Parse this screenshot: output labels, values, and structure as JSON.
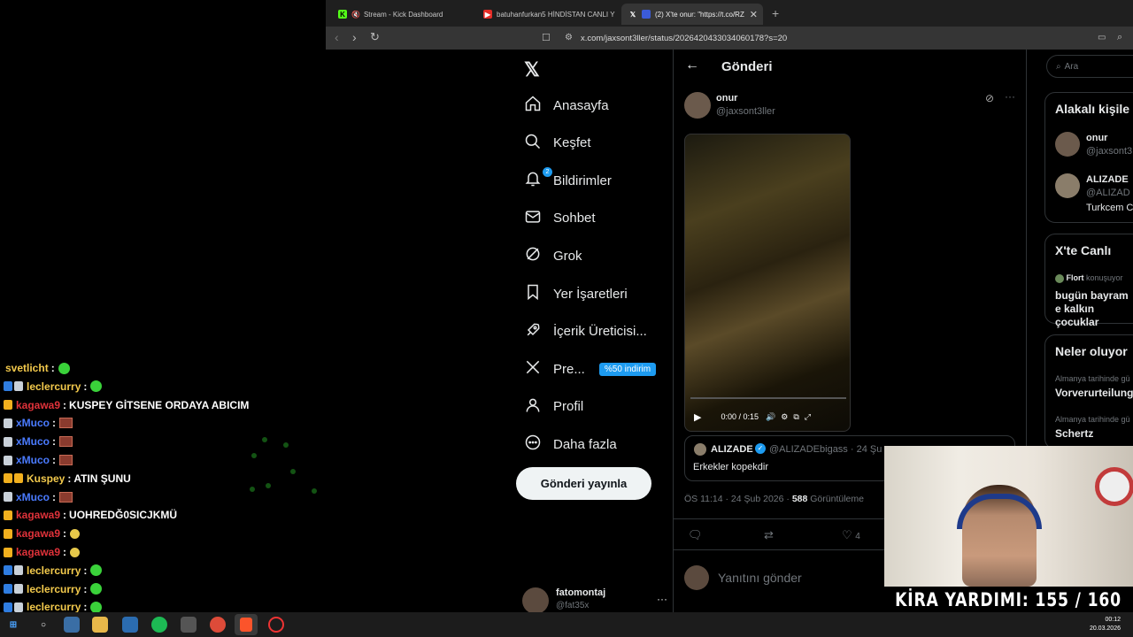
{
  "chat": {
    "messages": [
      {
        "user": "svetlicht",
        "color": "#f2c94c",
        "text": "",
        "badges": [],
        "emote": "green"
      },
      {
        "user": "leclercurry",
        "color": "#f2c94c",
        "text": "",
        "badges": [
          "blue",
          "silver"
        ],
        "emote": "green"
      },
      {
        "user": "kagawa9",
        "color": "#e0323a",
        "text": "KUSPEY GİTSENE ORDAYA ABICIM",
        "badges": [
          "gold"
        ],
        "emote": ""
      },
      {
        "user": "xMuco",
        "color": "#4a7bff",
        "text": "",
        "badges": [
          "silver"
        ],
        "emote": "img"
      },
      {
        "user": "xMuco",
        "color": "#4a7bff",
        "text": "",
        "badges": [
          "silver"
        ],
        "emote": "img"
      },
      {
        "user": "xMuco",
        "color": "#4a7bff",
        "text": "",
        "badges": [
          "silver"
        ],
        "emote": "img"
      },
      {
        "user": "Kuspey",
        "color": "#f2c94c",
        "text": "ATIN ŞUNU",
        "badges": [
          "gold",
          "gold"
        ],
        "emote": ""
      },
      {
        "user": "xMuco",
        "color": "#4a7bff",
        "text": "",
        "badges": [
          "silver"
        ],
        "emote": "img"
      },
      {
        "user": "kagawa9",
        "color": "#e0323a",
        "text": "UOHREDĞ0SICJKMÜ",
        "badges": [
          "gold"
        ],
        "emote": ""
      },
      {
        "user": "kagawa9",
        "color": "#e0323a",
        "text": "",
        "badges": [
          "gold"
        ],
        "emote": "yellow"
      },
      {
        "user": "kagawa9",
        "color": "#e0323a",
        "text": "",
        "badges": [
          "gold"
        ],
        "emote": "yellow"
      },
      {
        "user": "leclercurry",
        "color": "#f2c94c",
        "text": "",
        "badges": [
          "blue",
          "silver"
        ],
        "emote": "green"
      },
      {
        "user": "leclercurry",
        "color": "#f2c94c",
        "text": "",
        "badges": [
          "blue",
          "silver"
        ],
        "emote": "green"
      },
      {
        "user": "leclercurry",
        "color": "#f2c94c",
        "text": "",
        "badges": [
          "blue",
          "silver"
        ],
        "emote": "green"
      },
      {
        "user": "leclercurry",
        "color": "#f2c94c",
        "text": "",
        "badges": [
          "blue",
          "silver"
        ],
        "emote": "green"
      }
    ]
  },
  "browser": {
    "tabs": [
      {
        "title": "Stream - Kick Dashboard",
        "icon": "kick-icon",
        "active": false
      },
      {
        "title": "batuhanfurkan5 HİNDİSTAN CANLI Y",
        "icon": "youtube-icon",
        "active": false
      },
      {
        "title": "(2) X'te onur: \"https://t.co/RZ",
        "icon": "x-icon",
        "active": true
      }
    ],
    "new_tab": "+",
    "url": "x.com/jaxsont3ller/status/2026420433034060178?s=20"
  },
  "x": {
    "logo": "𝕏",
    "nav": [
      {
        "label": "Anasayfa",
        "icon": "home-icon"
      },
      {
        "label": "Keşfet",
        "icon": "search-icon"
      },
      {
        "label": "Bildirimler",
        "icon": "bell-icon",
        "badge": "2"
      },
      {
        "label": "Sohbet",
        "icon": "mail-icon"
      },
      {
        "label": "Grok",
        "icon": "grok-icon"
      },
      {
        "label": "Yer İşaretleri",
        "icon": "bookmark-icon"
      },
      {
        "label": "İçerik Üreticisi...",
        "icon": "rocket-icon"
      },
      {
        "label": "Pre...",
        "icon": "x-premium-icon",
        "promo": "%50 indirim"
      },
      {
        "label": "Profil",
        "icon": "profile-icon"
      },
      {
        "label": "Daha fazla",
        "icon": "more-circle-icon"
      }
    ],
    "post_button": "Gönderi yayınla",
    "account": {
      "name": "fatomontaj",
      "handle": "@fat35x"
    },
    "main": {
      "title": "Gönderi",
      "author": {
        "name": "onur",
        "handle": "@jaxsont3ller"
      },
      "video": {
        "time": "0:00 / 0:15"
      },
      "quote": {
        "name": "ALIZADE",
        "handle": "@ALIZADEbigass · 24 Şu",
        "text": "Erkekler kopekdir"
      },
      "meta": {
        "time": "ÖS 11:14 · 24 Şub 2026 · ",
        "views": "588",
        "views_label": " Görüntüleme"
      },
      "likes": "4",
      "reply_placeholder": "Yanıtını gönder"
    },
    "sidebar": {
      "search_placeholder": "Ara",
      "related_title": "Alakalı kişile",
      "related": [
        {
          "name": "onur",
          "handle": "@jaxsont3"
        },
        {
          "name": "ALIZADE",
          "handle": "@ALIZAD",
          "bio": "Turkcem C"
        }
      ],
      "live_title": "X'te Canlı",
      "live": {
        "host": "Flort",
        "status": "konuşuyor",
        "text": "bugün bayram e kalkın çocuklar"
      },
      "trends_title": "Neler oluyor",
      "trends": [
        {
          "context": "Almanya tarihinde gü",
          "title": "Vorverurteilung"
        },
        {
          "context": "Almanya tarihinde gü",
          "title": "Schertz"
        }
      ]
    }
  },
  "overlay": {
    "rent_text": "KİRA YARDIMI:  155 / 160"
  },
  "taskbar": {
    "time": "00:12",
    "date": "20.03.2026"
  }
}
